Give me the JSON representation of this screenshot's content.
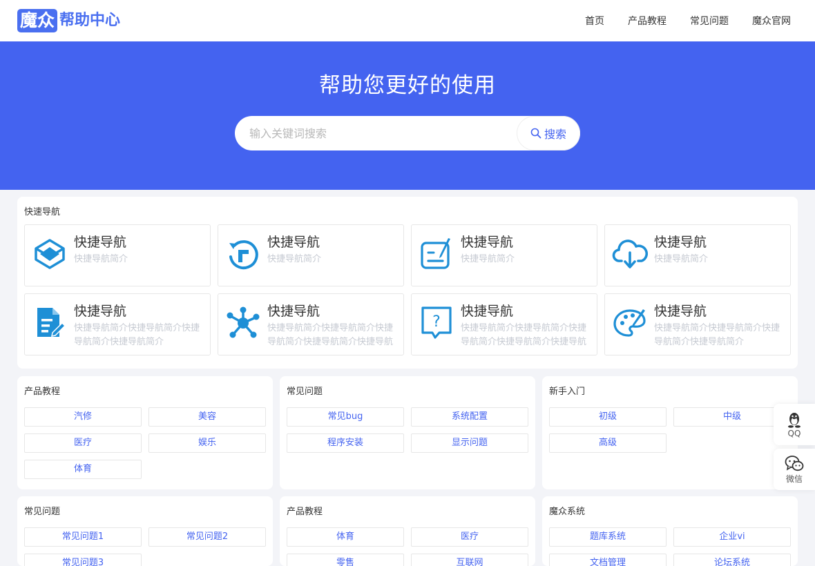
{
  "logo": {
    "badge": "魔众",
    "text": "帮助中心"
  },
  "nav": [
    "首页",
    "产品教程",
    "常见问题",
    "魔众官网"
  ],
  "hero": {
    "title": "帮助您更好的使用",
    "search_placeholder": "输入关键词搜索",
    "search_button": "搜索"
  },
  "quick_nav": {
    "title": "快速导航",
    "items": [
      {
        "icon": "layers-icon",
        "title": "快捷导航",
        "desc": "快捷导航简介"
      },
      {
        "icon": "refresh-icon",
        "title": "快捷导航",
        "desc": "快捷导航简介"
      },
      {
        "icon": "edit-box-icon",
        "title": "快捷导航",
        "desc": "快捷导航简介"
      },
      {
        "icon": "cloud-download-icon",
        "title": "快捷导航",
        "desc": "快捷导航简介"
      },
      {
        "icon": "document-edit-icon",
        "title": "快捷导航",
        "desc": "快捷导航简介快捷导航简介快捷导航简介快捷导航简介"
      },
      {
        "icon": "network-icon",
        "title": "快捷导航",
        "desc": "快捷导航简介快捷导航简介快捷导航简介快捷导航简介快捷导航"
      },
      {
        "icon": "question-bubble-icon",
        "title": "快捷导航",
        "desc": "快捷导航简介快捷导航简介快捷导航简介快捷导航简介快捷导航"
      },
      {
        "icon": "palette-icon",
        "title": "快捷导航",
        "desc": "快捷导航简介快捷导航简介快捷导航简介快捷导航简介"
      }
    ]
  },
  "panels": [
    {
      "title": "产品教程",
      "tags": [
        "汽修",
        "美容",
        "医疗",
        "娱乐",
        "体育"
      ]
    },
    {
      "title": "常见问题",
      "tags": [
        "常见bug",
        "系统配置",
        "程序安装",
        "显示问题"
      ]
    },
    {
      "title": "新手入门",
      "tags": [
        "初级",
        "中级",
        "高级"
      ]
    },
    {
      "title": "常见问题",
      "tags": [
        "常见问题1",
        "常见问题2",
        "常见问题3"
      ]
    },
    {
      "title": "产品教程",
      "tags": [
        "体育",
        "医疗",
        "零售",
        "互联网"
      ]
    },
    {
      "title": "魔众系统",
      "tags": [
        "题库系统",
        "企业vi",
        "文档管理",
        "论坛系统"
      ]
    }
  ],
  "float": {
    "qq": "QQ",
    "wechat": "微信"
  },
  "colors": {
    "primary": "#4463f0",
    "icon_blue": "#1e8fd6"
  }
}
